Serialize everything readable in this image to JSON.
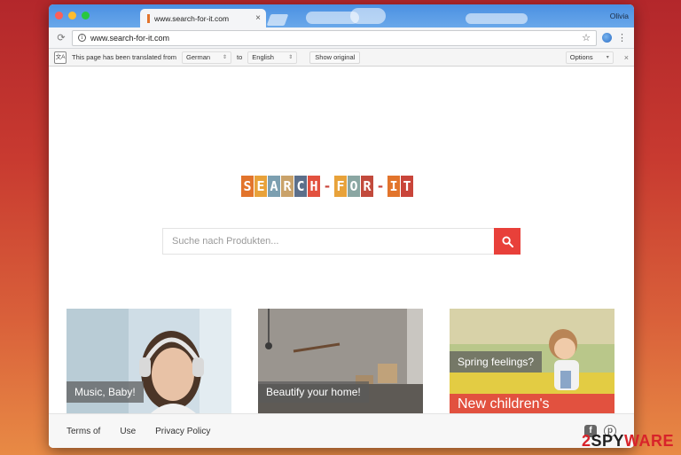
{
  "browser": {
    "tab_title": "www.search-for-it.com",
    "tab_close": "×",
    "profile_name": "Olivia",
    "url": "www.search-for-it.com",
    "reload_icon": "reload-icon",
    "star_icon": "star-icon",
    "menu_icon": "more-vert-icon"
  },
  "translate_bar": {
    "message": "This page has been translated from",
    "from_lang": "German",
    "to_word": "to",
    "to_lang": "English",
    "show_original": "Show original",
    "options": "Options",
    "close": "×"
  },
  "page": {
    "logo_text": "SEARCH-FOR-IT",
    "logo_colors": [
      "#e2742c",
      "#e8a23a",
      "#7c9fb0",
      "#c9a26a",
      "#5c6f8a",
      "#e2513f",
      "#7c9fb0",
      "#e8a23a",
      "#8aa6a2",
      "#c24a3c",
      "#7c9fb0",
      "#e2742c",
      "#c9453a"
    ],
    "search_placeholder": "Suche nach Produkten...",
    "search_button_color": "#e8403a",
    "cards": [
      {
        "label": "Music, Baby!",
        "banner": ""
      },
      {
        "label": "Beautify your home!",
        "banner": ""
      },
      {
        "label": "Spring feelings?",
        "banner": "New children's"
      }
    ]
  },
  "footer": {
    "links": [
      "Terms of",
      "Use",
      "Privacy Policy"
    ],
    "icons": [
      "facebook-icon",
      "pinterest-icon"
    ]
  },
  "watermark": {
    "part1": "2",
    "part2": "SPY",
    "part3": "WARE"
  }
}
